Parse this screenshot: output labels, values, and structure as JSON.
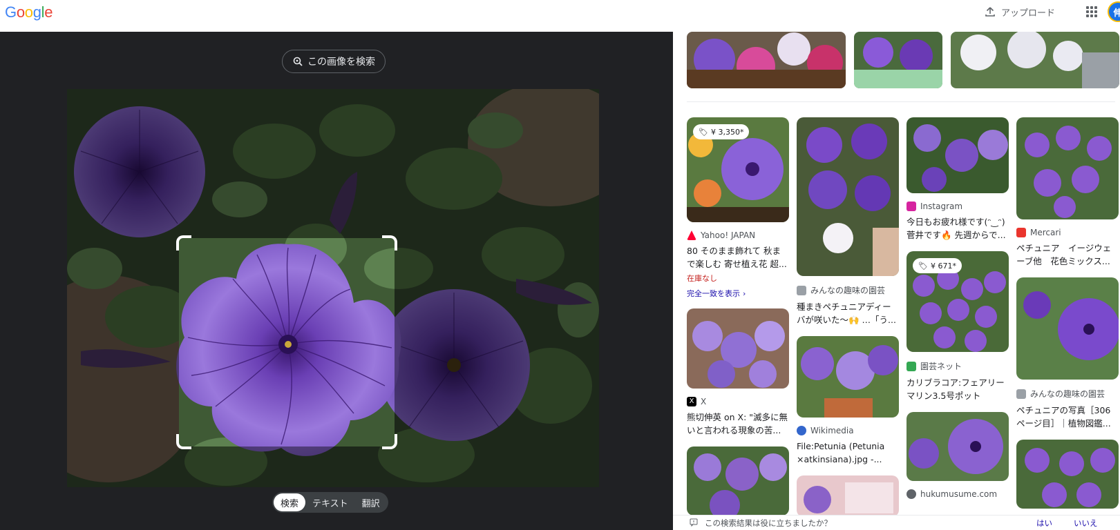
{
  "header": {
    "logo_letters": [
      "G",
      "o",
      "o",
      "g",
      "l",
      "e"
    ],
    "logo_colors": [
      "#4285f4",
      "#ea4335",
      "#fbbc05",
      "#4285f4",
      "#34a853",
      "#ea4335"
    ],
    "upload_label": "アップロード",
    "avatar_initial": "伸"
  },
  "lens": {
    "search_image_label": "この画像を検索",
    "tabs": [
      "検索",
      "テキスト",
      "翻訳"
    ],
    "active_tab": "検索"
  },
  "results": {
    "col1": [
      {
        "price": "¥ 3,350*",
        "source": "Yahoo! JAPAN",
        "title": "80 そのまま飾れて 秋まで楽しむ 寄せ植え花 超...",
        "stock": "在庫なし",
        "exact": "完全一致を表示"
      },
      {
        "source": "X",
        "title": "熊切伸英 on X: \"滅多に無いと言われる現象の苦..."
      },
      {}
    ],
    "col2": [
      {
        "source": "みんなの趣味の園芸",
        "title": "種まきペチュニアディーバが咲いた〜🙌 …「う..."
      },
      {
        "source": "Wikimedia",
        "title": "File:Petunia (Petunia ×atkinsiana).jpg -..."
      },
      {}
    ],
    "col3": [
      {
        "source": "Instagram",
        "title": "今日もお疲れ様です(ᵔ‿ᵔ) 菅井です🔥 先週からで..."
      },
      {
        "price": "¥ 671*",
        "source": "園芸ネット",
        "title": "カリブラコア:フェアリーマリン3.5号ポット"
      },
      {
        "source": "hukumusume.com",
        "title": ""
      }
    ],
    "col4": [
      {
        "source": "Mercari",
        "title": "ペチュニア　イージウェーブ他　花色ミックス..."
      },
      {
        "source": "みんなの趣味の園芸",
        "title": "ペチュニアの写真［306ページ目］｜植物図鑑..."
      },
      {}
    ]
  },
  "feedback": {
    "question": "この検索結果は役に立ちましたか？",
    "yes": "はい",
    "no": "いいえ"
  },
  "colors": {
    "petal": "#7b4fc0",
    "petal_light": "#b79ae6",
    "leaf": "#3f5e35",
    "dark_bg": "#202124"
  }
}
